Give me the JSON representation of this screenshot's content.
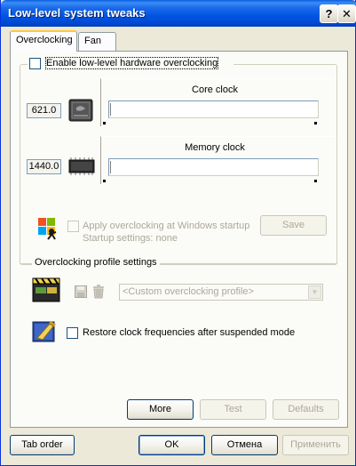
{
  "window": {
    "title": "Low-level system tweaks",
    "help_glyph": "?",
    "close_glyph": "✕"
  },
  "tabs": [
    {
      "label": "Overclocking",
      "active": true
    },
    {
      "label": "Fan",
      "active": false
    }
  ],
  "overclocking": {
    "enable_label": "Enable low-level hardware overclocking",
    "enable_checked": false,
    "core": {
      "label": "Core clock",
      "value": "621.0",
      "slider_fraction": 0.0
    },
    "memory": {
      "label": "Memory clock",
      "value": "1440.0",
      "slider_fraction": 0.0
    },
    "startup": {
      "apply_label": "Apply overclocking at Windows startup",
      "settings_label": "Startup settings: none",
      "save_label": "Save"
    },
    "profile": {
      "section_label": "Overclocking profile settings",
      "selected_profile": "<Custom overclocking profile>"
    },
    "restore_label": "Restore clock frequencies after suspended mode",
    "restore_checked": false,
    "buttons": {
      "more": "More",
      "test": "Test",
      "defaults": "Defaults"
    }
  },
  "footer": {
    "tab_order": "Tab order",
    "ok": "OK",
    "cancel": "Отмена",
    "apply": "Применить"
  },
  "icons": {
    "gpu_chip": "gpu-chip-icon",
    "memory_chip": "memory-chip-icon",
    "windows_startup": "windows-startup-icon",
    "profile_clapper": "clapperboard-icon",
    "save_profile": "floppy-disk-icon",
    "delete_profile": "trash-icon",
    "restore": "paint-brush-icon"
  },
  "colors": {
    "titlebar": "#0054e3",
    "window_bg": "#ece9d8",
    "panel_bg": "#fbfbf8",
    "tab_accent": "#ffc83c",
    "disabled_text": "#aca899"
  }
}
